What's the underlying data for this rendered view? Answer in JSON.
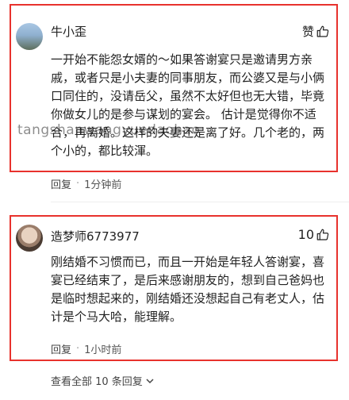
{
  "comments": [
    {
      "username": "牛小歪",
      "like_label": "赞",
      "content": "一开始不能怨女婿的～如果答谢宴只是邀请男方亲戚，或者只是小夫妻的同事朋友，而公婆又是与小俩口同住的，没请岳父，虽然不太好但也无大错，毕竟你做女儿的是参与谋划的宴会。 估计是觉得你不适合，再离婚。这样的夫妻还是离了好。几个老的，两个小的，都比较渾。",
      "reply_label": "回复",
      "time": "1分钟前"
    },
    {
      "username": "造梦师6773977",
      "like_count": "10",
      "content": "刚结婚不习惯而已，而且一开始是年轻人答谢宴，喜宴已经结束了，是后来感谢朋友的，想到自己爸妈也是临时想起来的，刚结婚还没想起自己有老丈人，估计是个马大哈，能理解。",
      "reply_label": "回复",
      "time": "1小时前"
    }
  ],
  "watermark": "tangshanwangyuedaohao",
  "view_all_label": "查看全部 10 条回复",
  "icons": {
    "like": "thumbs-up-icon",
    "expand": "chevron-down-icon"
  },
  "colors": {
    "highlight_border": "#e8322d"
  }
}
